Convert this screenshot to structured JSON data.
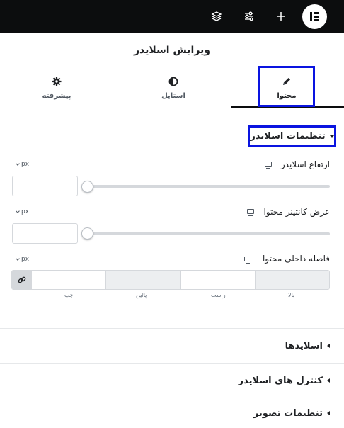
{
  "topbar": {
    "icons": [
      "layers-icon",
      "sliders-icon",
      "plus-icon",
      "elementor-logo"
    ]
  },
  "panel": {
    "title": "ویرایش اسلایدر"
  },
  "tabs": [
    {
      "label": "محتوا",
      "icon": "pencil-icon",
      "active": true
    },
    {
      "label": "استایل",
      "icon": "half-circle-icon",
      "active": false
    },
    {
      "label": "پیشرفته",
      "icon": "gear-icon",
      "active": false
    }
  ],
  "section_settings": {
    "label": "تنظیمات اسلایدر"
  },
  "controls": {
    "height": {
      "label": "ارتفاع اسلایدر",
      "unit": "px",
      "value": "",
      "slider": 0
    },
    "width": {
      "label": "عرض کانتینر محتوا",
      "unit": "px",
      "value": "",
      "slider": 0
    },
    "padding": {
      "label": "فاصله داخلی محتوا",
      "unit": "px",
      "sides": [
        "بالا",
        "راست",
        "پائین",
        "چپ"
      ]
    }
  },
  "sections": [
    {
      "label": "اسلایدها"
    },
    {
      "label": "کنترل های اسلایدر"
    },
    {
      "label": "تنظیمات تصویر"
    }
  ],
  "colors": {
    "accent_outline": "#0a14e0",
    "topbar": "#0c0d0e"
  }
}
